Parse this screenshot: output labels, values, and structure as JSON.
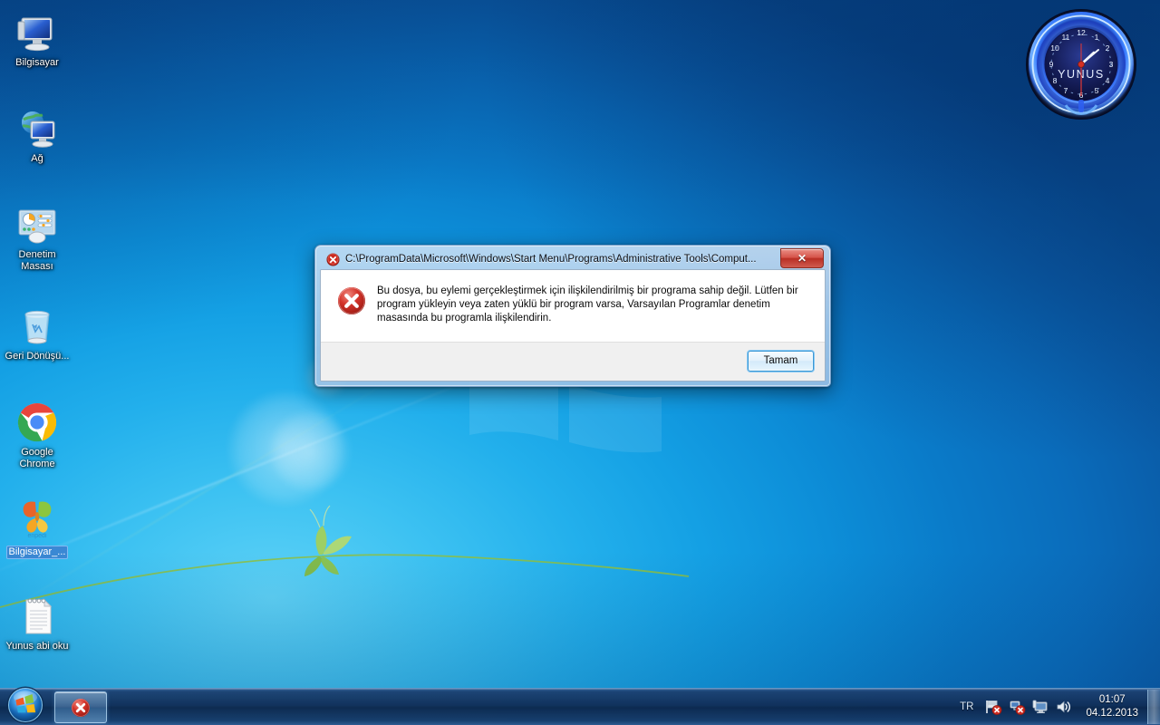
{
  "desktop": {
    "icons": [
      {
        "label": "Bilgisayar",
        "icon": "computer-icon",
        "selected": false
      },
      {
        "label": "Ağ",
        "icon": "network-icon",
        "selected": false
      },
      {
        "label": "Denetim Masası",
        "icon": "control-panel-icon",
        "selected": false
      },
      {
        "label": "Geri Dönüşü...",
        "icon": "recycle-bin-icon",
        "selected": false
      },
      {
        "label": "Google Chrome",
        "icon": "google-chrome-icon",
        "selected": false
      },
      {
        "label": "Bilgisayar_...",
        "icon": "enpedi-butterfly-icon",
        "selected": true
      },
      {
        "label": "Yunus abi oku",
        "icon": "text-file-icon",
        "selected": false
      }
    ]
  },
  "gadget": {
    "name": "clock-gadget",
    "brand_text": "YUNUS",
    "hour_numbers": [
      "12",
      "1",
      "2",
      "3",
      "4",
      "5",
      "6",
      "7",
      "8",
      "9",
      "10",
      "11"
    ],
    "time": "01:07",
    "neon_color": "#2b6cff",
    "face_color": "#141a52"
  },
  "dialog": {
    "title": "C:\\ProgramData\\Microsoft\\Windows\\Start Menu\\Programs\\Administrative Tools\\Comput...",
    "title_icon": "error-icon",
    "close_label": "✕",
    "error_icon": "error-icon",
    "message": "Bu dosya, bu eylemi gerçekleştirmek için ilişkilendirilmiş bir programa sahip değil. Lütfen bir program yükleyin veya zaten yüklü bir program varsa, Varsayılan Programlar denetim masasında bu programla ilişkilendirin.",
    "ok_label": "Tamam"
  },
  "taskbar": {
    "start_label": "start-orb",
    "task_buttons": [
      {
        "name": "taskbar-button-error-dialog",
        "icon": "error-icon",
        "active": true
      }
    ],
    "tray": {
      "language": "TR",
      "icons": [
        {
          "name": "action-center-flag-icon",
          "badge": "error"
        },
        {
          "name": "network-icon",
          "badge": "error"
        },
        {
          "name": "display-monitor-icon",
          "badge": "none"
        },
        {
          "name": "volume-speaker-icon",
          "badge": "none"
        }
      ],
      "time": "01:07",
      "date": "04.12.2013",
      "show_desktop_label": "show-desktop-button"
    }
  },
  "colors": {
    "accent_blue": "#0a7bc9",
    "taskbar_blue": "#102e58",
    "error_red": "#c4231a",
    "dialog_face": "#ffffff",
    "footer_gray": "#f0f0f0"
  }
}
